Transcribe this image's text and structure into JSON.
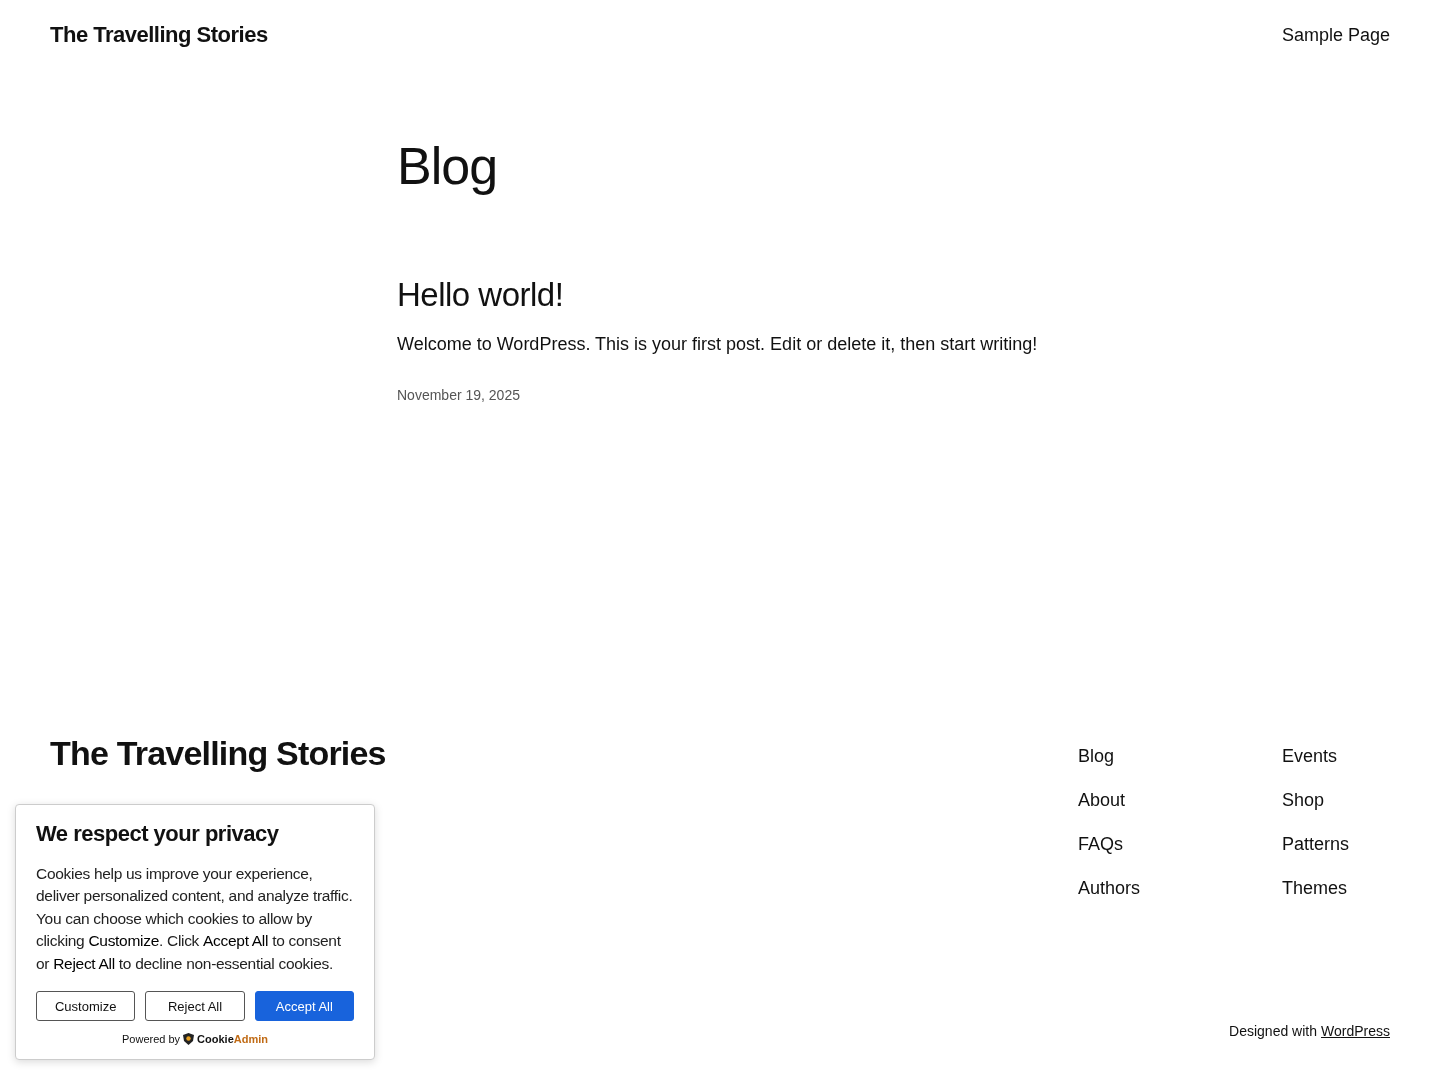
{
  "header": {
    "site_title": "The Travelling Stories",
    "nav": [
      "Sample Page"
    ]
  },
  "main": {
    "title": "Blog",
    "posts": [
      {
        "title": "Hello world!",
        "excerpt": "Welcome to WordPress. This is your first post. Edit or delete it, then start writing!",
        "date": "November 19, 2025"
      }
    ]
  },
  "footer": {
    "site_title": "The Travelling Stories",
    "nav_columns": [
      [
        "Blog",
        "About",
        "FAQs",
        "Authors"
      ],
      [
        "Events",
        "Shop",
        "Patterns",
        "Themes"
      ]
    ],
    "credit": {
      "text": "Designed with",
      "link": "WordPress"
    }
  },
  "cookie_banner": {
    "title": "We respect your privacy",
    "body": "Cookies help us improve your experience, deliver personalized content, and analyze traffic. You can choose which cookies to allow by clicking **Customize**. Click **Accept All** to consent or **Reject All** to decline non-essential cookies.",
    "buttons": [
      {
        "label": "Customize",
        "kind": "outline"
      },
      {
        "label": "Reject All",
        "kind": "outline"
      },
      {
        "label": "Accept All",
        "kind": "primary"
      }
    ],
    "powered_by": "Powered by",
    "logo": {
      "part_1": "Cookie",
      "part_2": "Admin"
    }
  }
}
